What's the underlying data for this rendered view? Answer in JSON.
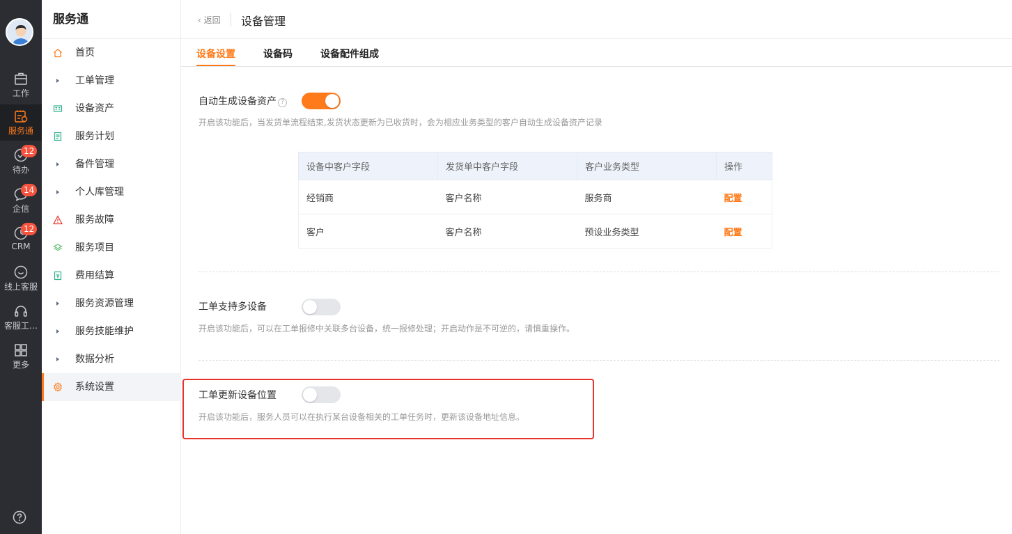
{
  "rail": {
    "items": [
      {
        "label": "工作",
        "icon": "briefcase-icon",
        "badge": ""
      },
      {
        "label": "服务通",
        "icon": "service-icon",
        "badge": ""
      },
      {
        "label": "待办",
        "icon": "todo-check-icon",
        "badge": "12"
      },
      {
        "label": "企信",
        "icon": "chat-bubble-icon",
        "badge": "14"
      },
      {
        "label": "CRM",
        "icon": "crm-clock-icon",
        "badge": "12"
      },
      {
        "label": "线上客服",
        "icon": "online-service-icon",
        "badge": ""
      },
      {
        "label": "客服工…",
        "icon": "headset-icon",
        "badge": ""
      },
      {
        "label": "更多",
        "icon": "grid-more-icon",
        "badge": ""
      }
    ],
    "active_index": 1
  },
  "submenu": {
    "title": "服务通",
    "items": [
      {
        "label": "首页",
        "icon": "home-icon"
      },
      {
        "label": "工单管理",
        "icon": "caret-right-icon"
      },
      {
        "label": "设备资产",
        "icon": "device-asset-icon"
      },
      {
        "label": "服务计划",
        "icon": "plan-doc-icon"
      },
      {
        "label": "备件管理",
        "icon": "caret-right-icon"
      },
      {
        "label": "个人库管理",
        "icon": "caret-right-icon"
      },
      {
        "label": "服务故障",
        "icon": "warning-icon"
      },
      {
        "label": "服务项目",
        "icon": "layers-icon"
      },
      {
        "label": "费用结算",
        "icon": "yen-doc-icon"
      },
      {
        "label": "服务资源管理",
        "icon": "caret-right-icon"
      },
      {
        "label": "服务技能维护",
        "icon": "caret-right-icon"
      },
      {
        "label": "数据分析",
        "icon": "caret-right-icon"
      },
      {
        "label": "系统设置",
        "icon": "settings-gear-icon"
      }
    ],
    "active_index": 12
  },
  "header": {
    "back_label": "返回",
    "title": "设备管理"
  },
  "tabs": [
    {
      "label": "设备设置"
    },
    {
      "label": "设备码"
    },
    {
      "label": "设备配件组成"
    }
  ],
  "active_tab": 0,
  "settings": {
    "auto_asset": {
      "label": "自动生成设备资产",
      "enabled": true,
      "desc": "开启该功能后，当发货单流程结束,发货状态更新为已收货时，会为相应业务类型的客户自动生成设备资产记录"
    },
    "table": {
      "headers": [
        "设备中客户字段",
        "发货单中客户字段",
        "客户业务类型",
        "操作"
      ],
      "rows": [
        {
          "device_field": "经销商",
          "delivery_field": "客户名称",
          "biz_type": "服务商",
          "action": "配置"
        },
        {
          "device_field": "客户",
          "delivery_field": "客户名称",
          "biz_type": "预设业务类型",
          "action": "配置"
        }
      ]
    },
    "multi_device": {
      "label": "工单支持多设备",
      "enabled": false,
      "desc": "开启该功能后，可以在工单报修中关联多台设备，统一报修处理；开启动作是不可逆的，请慎重操作。"
    },
    "update_location": {
      "label": "工单更新设备位置",
      "enabled": false,
      "desc": "开启该功能后，服务人员可以在执行某台设备相关的工单任务时，更新该设备地址信息。"
    }
  },
  "colors": {
    "accent": "#ff7a1a",
    "rail_bg": "#2b2d33",
    "badge": "#f5533d",
    "highlight_border": "#e8322b"
  }
}
